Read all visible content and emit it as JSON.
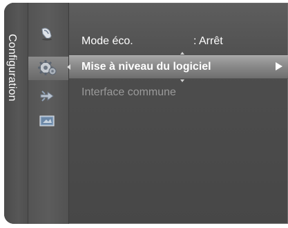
{
  "sidebar": {
    "title": "Configuration"
  },
  "categories": [
    {
      "icon": "picture-icon",
      "selected": false
    },
    {
      "icon": "setup-gear-icon",
      "selected": true
    },
    {
      "icon": "input-icon",
      "selected": false
    },
    {
      "icon": "application-icon",
      "selected": false
    }
  ],
  "menu": {
    "items": [
      {
        "label": "Mode éco.",
        "value": ": Arrêt",
        "state": "normal"
      },
      {
        "label": "Mise à niveau du logiciel",
        "value": "",
        "state": "selected"
      },
      {
        "label": "Interface commune",
        "value": "",
        "state": "disabled"
      }
    ]
  },
  "colors": {
    "panel": "#4d4d4d",
    "selected_row": "#8a8a8a",
    "text": "#ffffff",
    "disabled_text": "#9a9a9a"
  }
}
